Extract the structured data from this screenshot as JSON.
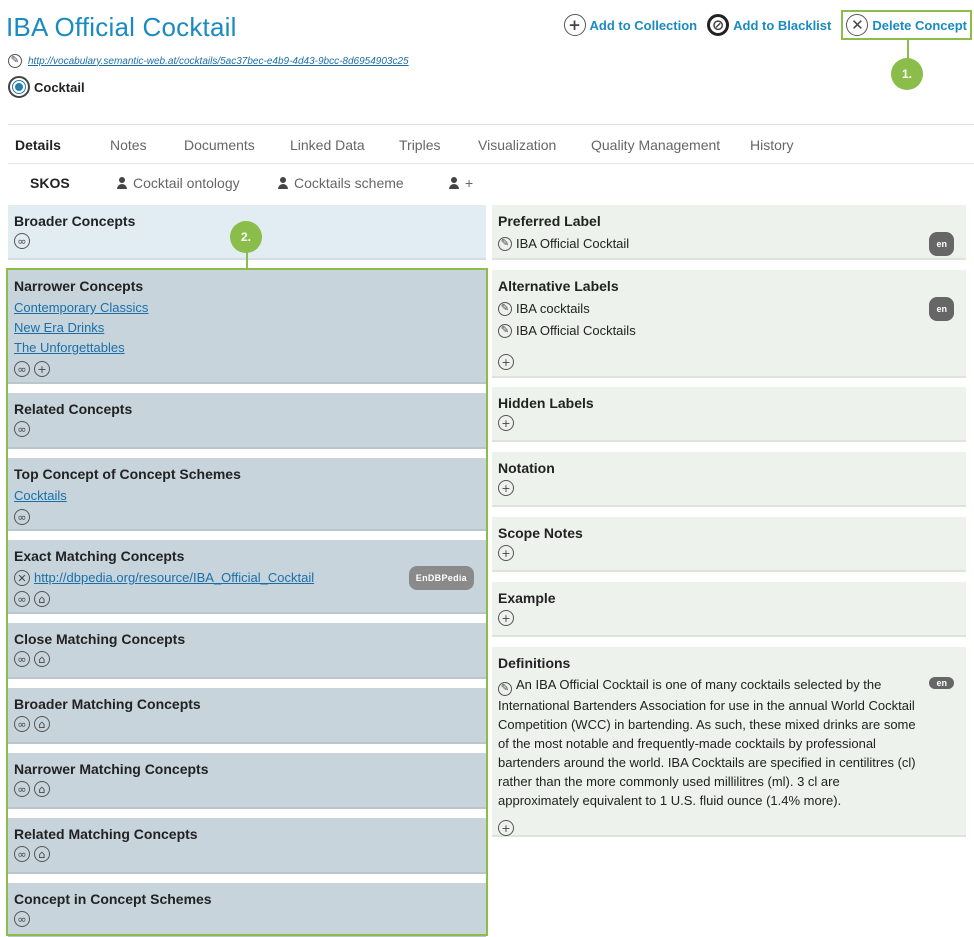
{
  "concept": {
    "title": "IBA Official Cocktail",
    "uri": "http://vocabulary.semantic-web.at/cocktails/5ac37bec-e4b9-4d43-9bcc-8d6954903c25",
    "type": "Cocktail"
  },
  "actions": {
    "add_collection": "Add to Collection",
    "add_blacklist": "Add to Blacklist",
    "delete_concept": "Delete Concept"
  },
  "callouts": {
    "one": "1.",
    "two": "2."
  },
  "tabs": [
    "Details",
    "Notes",
    "Documents",
    "Linked Data",
    "Triples",
    "Visualization",
    "Quality Management",
    "History"
  ],
  "subtabs": {
    "skos": "SKOS",
    "ontology": "Cocktail ontology",
    "scheme": "Cocktails scheme",
    "add": "+"
  },
  "left": {
    "broader": {
      "title": "Broader Concepts"
    },
    "narrower": {
      "title": "Narrower Concepts",
      "items": [
        "Contemporary Classics",
        "New Era Drinks",
        "The Unforgettables"
      ]
    },
    "related": {
      "title": "Related Concepts"
    },
    "top_concept": {
      "title": "Top Concept of Concept Schemes",
      "items": [
        "Cocktails"
      ]
    },
    "exact": {
      "title": "Exact Matching Concepts",
      "link": "http://dbpedia.org/resource/IBA_Official_Cocktail",
      "badge": "EnDBPedia"
    },
    "close": {
      "title": "Close Matching Concepts"
    },
    "broader_match": {
      "title": "Broader Matching Concepts"
    },
    "narrower_match": {
      "title": "Narrower Matching Concepts"
    },
    "related_match": {
      "title": "Related Matching Concepts"
    },
    "in_scheme": {
      "title": "Concept in Concept Schemes"
    }
  },
  "right": {
    "pref": {
      "title": "Preferred Label",
      "value": "IBA Official Cocktail",
      "lang": "en"
    },
    "alt": {
      "title": "Alternative Labels",
      "values": [
        "IBA cocktails",
        "IBA Official Cocktails"
      ],
      "lang": "en"
    },
    "hidden": {
      "title": "Hidden Labels"
    },
    "notation": {
      "title": "Notation"
    },
    "scope": {
      "title": "Scope Notes"
    },
    "example": {
      "title": "Example"
    },
    "definitions": {
      "title": "Definitions",
      "lang": "en",
      "text": "An IBA Official Cocktail is one of many cocktails selected by the International Bartenders Association for use in the annual World Cocktail Competition (WCC) in bartending. As such, these mixed drinks are some of the most notable and frequently-made cocktails by professional bartenders around the world. IBA Cocktails are specified in centilitres (cl) rather than the more commonly used millilitres (ml). 3 cl are approximately equivalent to 1 U.S. fluid ounce (1.4% more)."
    }
  },
  "icons": {
    "edit": "pencil-icon",
    "link": "link-icon",
    "add": "plus-icon",
    "remove": "close-icon",
    "map": "mountain-icon",
    "blacklist": "blocked-icon"
  },
  "colors": {
    "accent": "#1a8bc1",
    "highlight": "#8bbd4a",
    "panel_blue": "#e2edf3",
    "panel_slate": "#c7d4dc",
    "panel_green": "#edf2ec"
  }
}
